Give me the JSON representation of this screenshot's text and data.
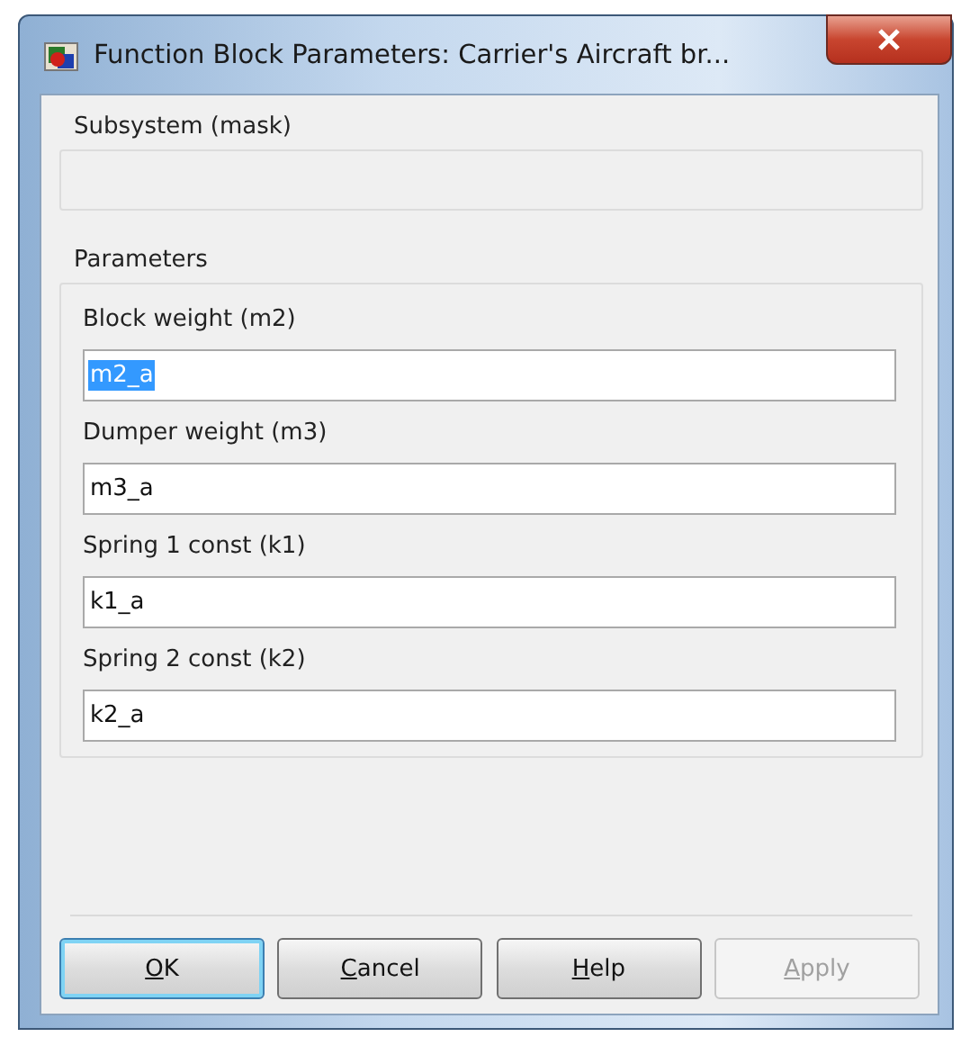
{
  "window": {
    "title": "Function Block Parameters: Carrier's Aircraft br..."
  },
  "description_group": {
    "title": "Subsystem (mask)"
  },
  "parameters_group": {
    "title": "Parameters",
    "fields": [
      {
        "label": "Block weight (m2)",
        "value": "m2_a",
        "selected": true
      },
      {
        "label": "Dumper weight (m3)",
        "value": "m3_a",
        "selected": false
      },
      {
        "label": "Spring 1 const (k1)",
        "value": "k1_a",
        "selected": false
      },
      {
        "label": "Spring 2 const (k2)",
        "value": "k2_a",
        "selected": false
      }
    ]
  },
  "buttons": [
    {
      "label": "OK",
      "default": true,
      "disabled": false
    },
    {
      "label": "Cancel",
      "default": false,
      "disabled": false
    },
    {
      "label": "Help",
      "default": false,
      "disabled": false
    },
    {
      "label": "Apply",
      "default": false,
      "disabled": true
    }
  ]
}
